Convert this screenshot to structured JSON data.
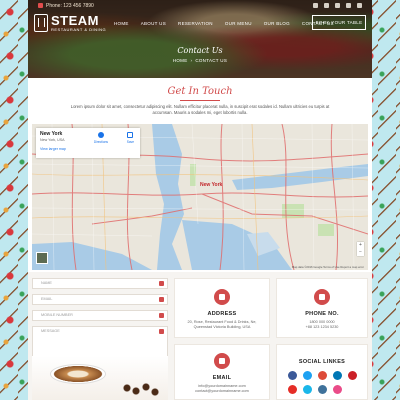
{
  "topbar": {
    "phone": "Phone: 123 456 7890",
    "icons": [
      "twitter-icon",
      "facebook-icon",
      "google-plus-icon",
      "linkedin-icon",
      "rss-icon"
    ]
  },
  "brand": {
    "name": "STEAM",
    "tagline": "RESTAURANT & DINING"
  },
  "nav": {
    "items": [
      "HOME",
      "ABOUT US",
      "RESERVATION",
      "OUR MENU",
      "OUR BLOG",
      "CONTACT US"
    ]
  },
  "book_button": "BOOK YOUR TABLE",
  "hero": {
    "title": "Contact Us",
    "breadcrumb": [
      "HOME",
      "CONTACT US"
    ],
    "breadcrumb_sep": "›"
  },
  "intro": {
    "title": "Get In Touch",
    "text": "Lorem ipsum dolor sit amet, consectetur adipiscing elit. Nullam efficitur placerat nulla, in suscipit erat sodales id. Nullam ultricies eu turpis at accumsan. Mauris a sodales mi, eget lobortis nulla."
  },
  "map": {
    "place": "New York",
    "place_sub": "New York, USA",
    "directions": "Directions",
    "save": "Save",
    "larger_map": "View larger map",
    "pin_label": "New York",
    "zoom_in": "+",
    "zoom_out": "−",
    "footer": "Map data ©2016 Google   Terms of Use   Report a map error",
    "colors": {
      "water": "#a9cbe6",
      "land": "#eae6dc",
      "roads": "#e06b6b",
      "park": "#c9e2b3"
    }
  },
  "form": {
    "name_placeholder": "NAME",
    "email_placeholder": "EMAIL",
    "mobile_placeholder": "MOBILE NUMBER",
    "message_placeholder": "MESSAGE"
  },
  "address": {
    "title": "ADDRESS",
    "lines": [
      "20, Rose, Restaurant Food & Drinks, Ne,",
      "Queenstad Victoria Building, USA"
    ]
  },
  "phone": {
    "title": "PHONE NO.",
    "lines": [
      "1800 000 0000",
      "+88 123 1234 5230"
    ]
  },
  "email": {
    "title": "EMAIL",
    "lines": [
      "info@yourdomainname.com",
      "contact@yourdomainname.com"
    ]
  },
  "social": {
    "title": "SOCIAL LINKES",
    "items": [
      {
        "icon": "facebook-icon",
        "color": "#3b5998"
      },
      {
        "icon": "twitter-icon",
        "color": "#1da1f2"
      },
      {
        "icon": "google-plus-icon",
        "color": "#dd4b39"
      },
      {
        "icon": "linkedin-icon",
        "color": "#0077b5"
      },
      {
        "icon": "pinterest-icon",
        "color": "#cb2027"
      },
      {
        "icon": "youtube-icon",
        "color": "#e52d27"
      },
      {
        "icon": "vimeo-icon",
        "color": "#1ab7ea"
      },
      {
        "icon": "instagram-icon",
        "color": "#3f729b"
      },
      {
        "icon": "dribbble-icon",
        "color": "#ea4c89"
      }
    ]
  },
  "accent": "#d14b4b"
}
